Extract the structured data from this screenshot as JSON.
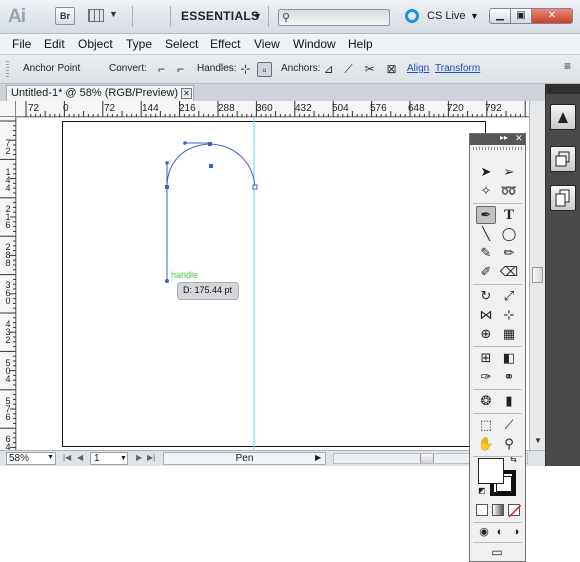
{
  "app": {
    "logo": "Ai",
    "bridge_label": "Br",
    "workspace": "ESSENTIALS",
    "search_placeholder": "",
    "cslive": "CS Live"
  },
  "menu": [
    "File",
    "Edit",
    "Object",
    "Type",
    "Select",
    "Effect",
    "View",
    "Window",
    "Help"
  ],
  "control_bar": {
    "anchor_point": "Anchor Point",
    "convert": "Convert:",
    "handles": "Handles:",
    "anchors": "Anchors:",
    "align": "Align",
    "transform": "Transform"
  },
  "document": {
    "tab_title": "Untitled-1* @ 58% (RGB/Preview)",
    "ruler_top": [
      "72",
      "0",
      "72",
      "144",
      "216",
      "288",
      "360",
      "432",
      "504",
      "576",
      "648",
      "720",
      "792"
    ],
    "ruler_left": [
      "7\n2",
      "1\n4\n4",
      "2\n1\n6",
      "2\n8\n8",
      "3\n6\n0",
      "4\n3\n2",
      "5\n0\n4",
      "5\n7\n6",
      "6\n4\n8"
    ],
    "smart_guide_label": "handle",
    "tooltip": "D: 175.44 pt"
  },
  "status": {
    "zoom": "58%",
    "page": "1",
    "tool": "Pen"
  },
  "colors": {
    "accent_blue": "#1f93d6",
    "guide_cyan": "#7fe0ee",
    "path_blue": "#3a62c9",
    "smart_guide_green": "#3ecf3e"
  }
}
